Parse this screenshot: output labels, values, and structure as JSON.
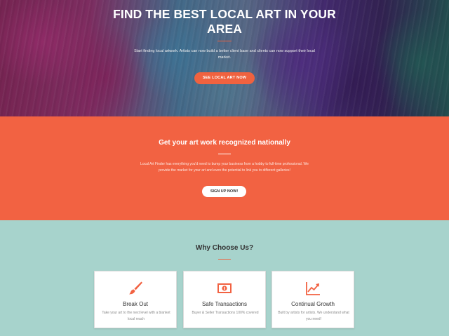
{
  "hero": {
    "title": "FIND THE BEST LOCAL ART IN YOUR AREA",
    "subtitle": "Start finding local artwork. Artists can now build a better client base and clients can now support their local market.",
    "button_label": "SEE LOCAL ART NOW"
  },
  "promo": {
    "title": "Get your art work recognized nationally",
    "text": "Local Art Finder has everything you'd need to bump your business from a hobby to full-time professional. We provide the market for your art and even the potential to link you to different galleries!",
    "button_label": "SIGN UP NOW!"
  },
  "why": {
    "title": "Why Choose Us?",
    "cards": [
      {
        "icon": "paintbrush-icon",
        "title": "Break Out",
        "text": "Take your art to the next level with a blanket local reach"
      },
      {
        "icon": "money-icon",
        "title": "Safe Transactions",
        "text": "Buyer & Seller Transactions 100% covered"
      },
      {
        "icon": "growth-chart-icon",
        "title": "Continual Growth",
        "text": "Built by artists for artists. We understand what you need!"
      }
    ]
  },
  "colors": {
    "accent": "#f26242",
    "teal_background": "#a7d3cc",
    "card_background": "#ffffff"
  }
}
